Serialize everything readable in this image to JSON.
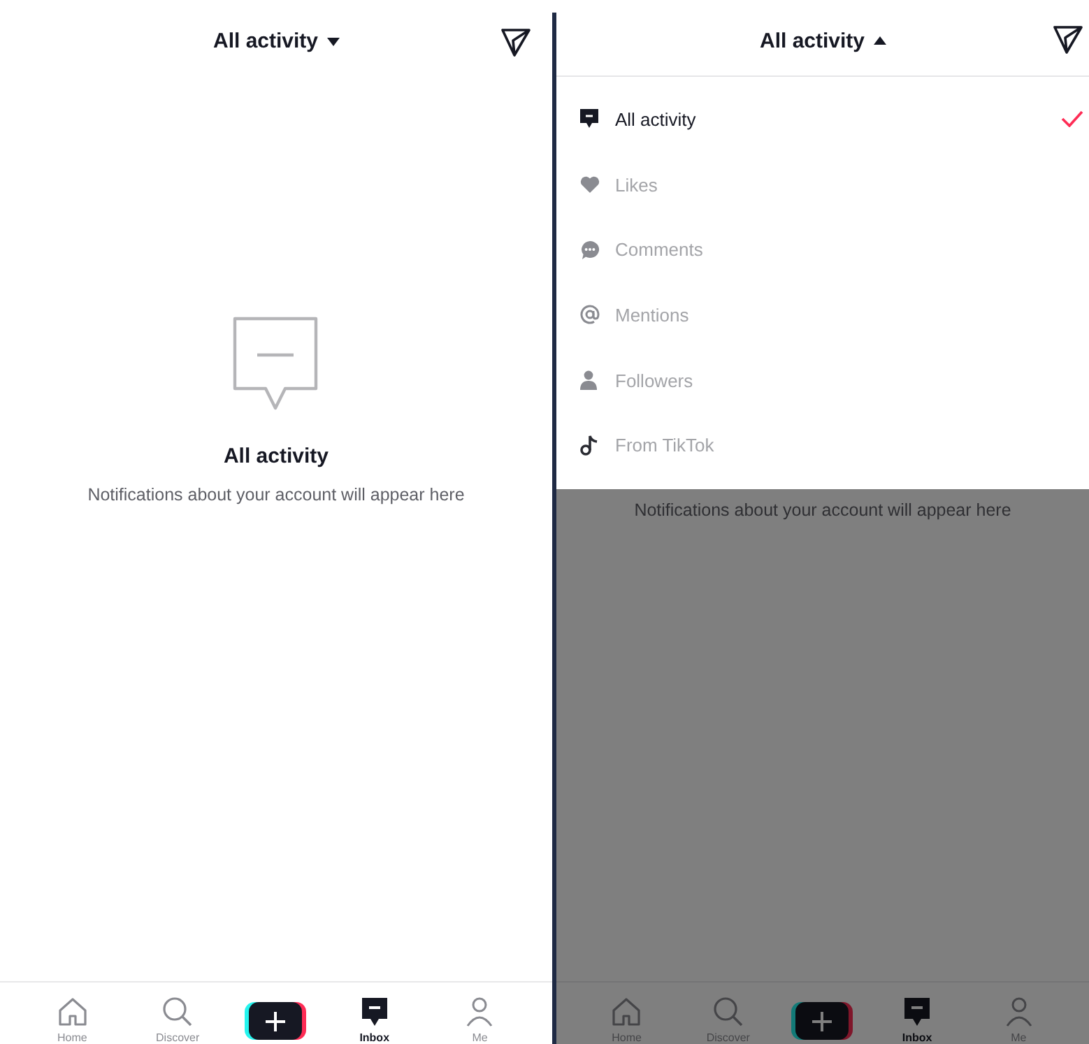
{
  "screens": [
    {
      "header": {
        "title": "All activity",
        "expanded": false
      },
      "empty_state": {
        "title": "All activity",
        "message": "Notifications about your account will appear here"
      },
      "tab_bar": [
        {
          "kind": "home",
          "label": "Home",
          "selected": false
        },
        {
          "kind": "discover",
          "label": "Discover",
          "selected": false
        },
        {
          "kind": "create"
        },
        {
          "kind": "inbox",
          "label": "Inbox",
          "selected": true
        },
        {
          "kind": "me",
          "label": "Me",
          "selected": false
        }
      ]
    },
    {
      "header": {
        "title": "All activity",
        "expanded": true
      },
      "menu": [
        {
          "kind": "message",
          "label": "All activity",
          "selected": true
        },
        {
          "kind": "heart",
          "label": "Likes",
          "selected": false
        },
        {
          "kind": "comment",
          "label": "Comments",
          "selected": false
        },
        {
          "kind": "at",
          "label": "Mentions",
          "selected": false
        },
        {
          "kind": "person",
          "label": "Followers",
          "selected": false
        },
        {
          "kind": "note",
          "label": "From TikTok",
          "selected": false
        }
      ],
      "empty_state": {
        "message": "Notifications about your account will appear here"
      },
      "tab_bar": [
        {
          "kind": "home",
          "label": "Home",
          "selected": false
        },
        {
          "kind": "discover",
          "label": "Discover",
          "selected": false
        },
        {
          "kind": "create"
        },
        {
          "kind": "inbox",
          "label": "Inbox",
          "selected": true
        },
        {
          "kind": "me",
          "label": "Me",
          "selected": false
        }
      ]
    }
  ]
}
